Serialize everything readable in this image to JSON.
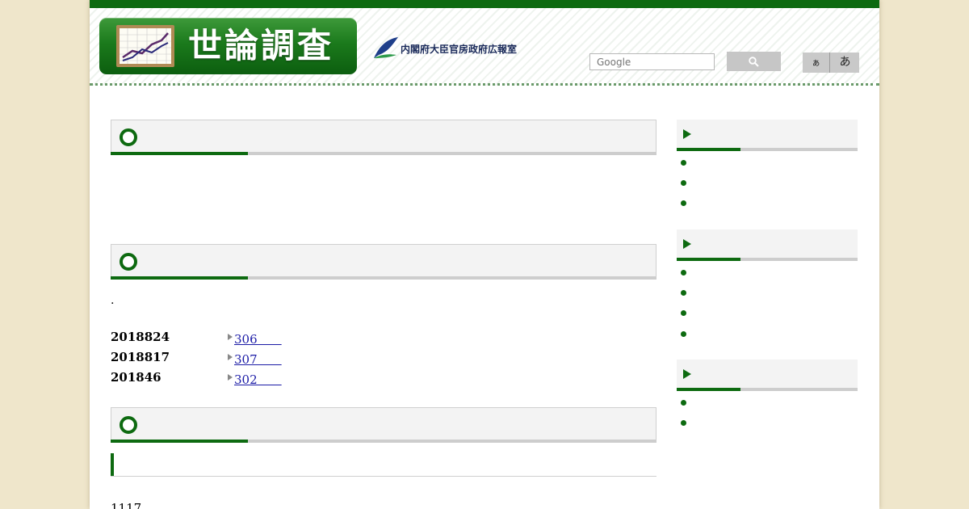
{
  "header": {
    "logo_title": "世論調査",
    "agency_name": "内閣府大臣官房政府広報室",
    "search_placeholder": "Google",
    "font_small_label": "ぁ",
    "font_large_label": "あ"
  },
  "main": {
    "dot_text": ".",
    "news": [
      {
        "date": "2018824",
        "link": "306　　"
      },
      {
        "date": "2018817",
        "link": "307　　"
      },
      {
        "date": "201846",
        "link": "302　　"
      }
    ],
    "bottom_text": "1117"
  },
  "icons": {
    "logo": "chart-icon",
    "agency": "leaf-emblem-icon",
    "search": "search-icon",
    "section": "ring-icon",
    "sidebar": "play-triangle-icon",
    "bullet": "bullet-dot-icon",
    "news": "triangle-right-icon"
  },
  "colors": {
    "brand_green": "#0d6a10",
    "background": "#efe6cb",
    "link": "#1a1aa6"
  }
}
